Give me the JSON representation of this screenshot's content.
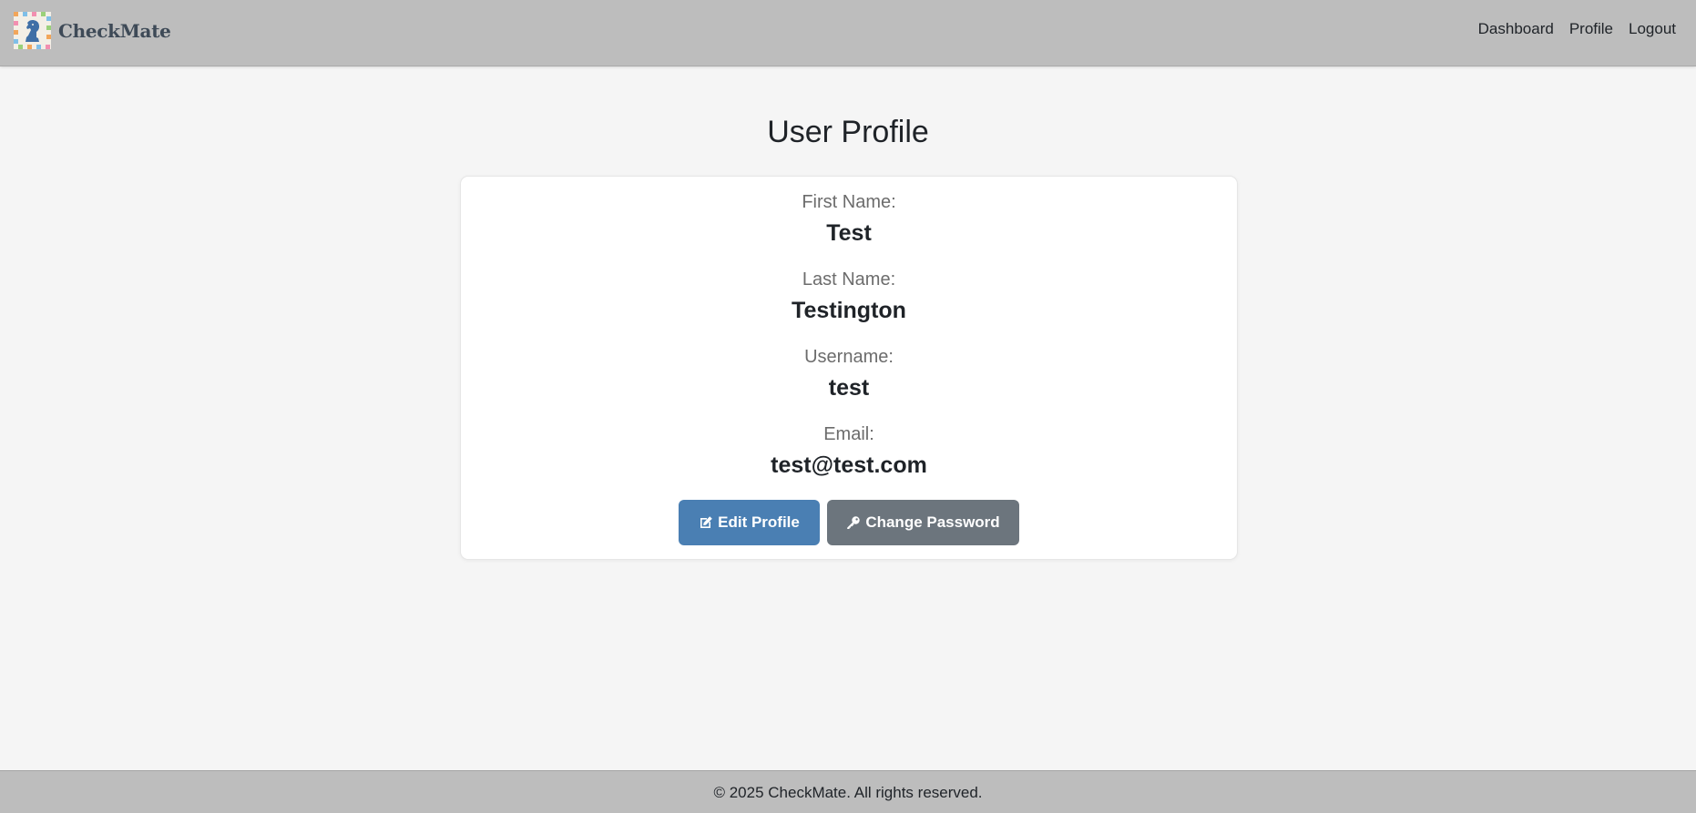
{
  "header": {
    "brand": "CheckMate",
    "logo_icon": "chess-knight-logo-icon",
    "nav": [
      {
        "label": "Dashboard"
      },
      {
        "label": "Profile"
      },
      {
        "label": "Logout"
      }
    ]
  },
  "main": {
    "title": "User Profile",
    "fields": [
      {
        "label": "First Name:",
        "value": "Test"
      },
      {
        "label": "Last Name:",
        "value": "Testington"
      },
      {
        "label": "Username:",
        "value": "test"
      },
      {
        "label": "Email:",
        "value": "test@test.com"
      }
    ],
    "buttons": {
      "edit": {
        "label": "Edit Profile",
        "icon": "edit-icon",
        "color": "#4a7fb3"
      },
      "password": {
        "label": "Change Password",
        "icon": "key-icon",
        "color": "#6c757d"
      }
    }
  },
  "footer": {
    "text": "© 2025 CheckMate. All rights reserved."
  }
}
